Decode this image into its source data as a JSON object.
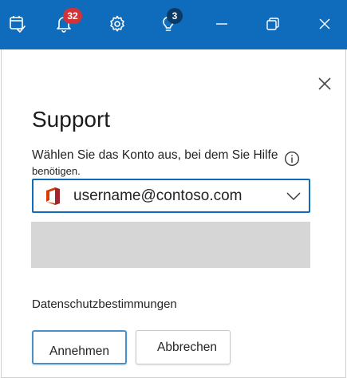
{
  "titlebar": {
    "background": "#0f6cbd",
    "buttons": [
      {
        "icon": "calendar-check-icon"
      },
      {
        "icon": "bell-icon",
        "badge": "32",
        "badge_color": "#d13438"
      },
      {
        "icon": "gear-icon"
      },
      {
        "icon": "lightbulb-icon",
        "badge": "3",
        "badge_color": "#0a3a66"
      },
      {
        "icon": "minimize-icon"
      },
      {
        "icon": "restore-icon"
      },
      {
        "icon": "close-icon"
      }
    ]
  },
  "panel": {
    "title": "Support",
    "prompt_line1": "Wählen Sie das Konto aus, bei dem Sie Hilfe",
    "prompt_line2": "benötigen.",
    "account_select": {
      "value": "username@contoso.com",
      "icon": "office-icon",
      "accent": "#0f6cbd"
    },
    "privacy_link": "Datenschutzbestimmungen",
    "accept_button": "Annehmen",
    "cancel_button": "Abbrechen"
  }
}
